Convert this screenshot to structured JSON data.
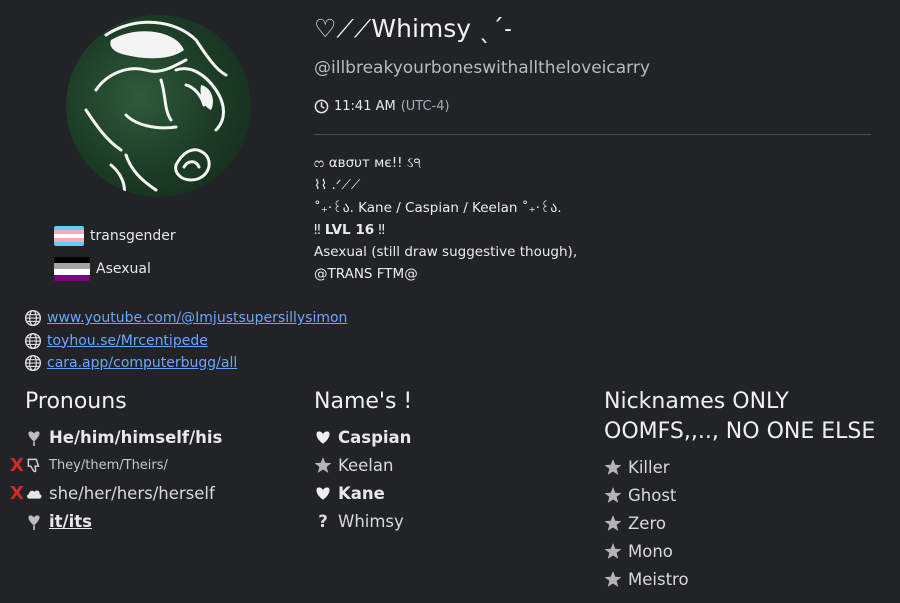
{
  "profile": {
    "display_name": "♡⟋⟋Whimsy ˎˊ˗",
    "handle": "@illbreakyourboneswithalltheloveicarry",
    "time": "11:41 AM",
    "timezone": "(UTC-4)"
  },
  "flags": [
    {
      "label": "transgender",
      "colors": [
        "#5bcefa",
        "#f5a9b8",
        "#ffffff",
        "#f5a9b8",
        "#5bcefa"
      ]
    },
    {
      "label": "Asexual",
      "colors": [
        "#000000",
        "#a3a3a3",
        "#ffffff",
        "#800080"
      ]
    }
  ],
  "bio": {
    "line1": "ᦂ αвσυт мє!! ઽ੧",
    "line2": "⌇⌇ .ᐟ⟋⟋",
    "line3": "˚₊‧꒰ა. Kane / Caspian / Keelan ˚₊‧꒰ა.",
    "line4_pre": "‼ ",
    "line4_bold": "LVL 16",
    "line4_post": " ‼",
    "line5": "Asexual (still draw suggestive though),",
    "line6": "@TRANS FTM@"
  },
  "links": [
    "www.youtube.com/@Imjustsupersillysimon",
    "toyhou.se/Mrcentipede",
    "cara.app/computerbugg/all"
  ],
  "pronouns": {
    "title": "Pronouns",
    "items": [
      {
        "text": "He/him/himself/his"
      },
      {
        "text": "They/them/Theirs/",
        "x": "X"
      },
      {
        "text": "she/her/hers/herself",
        "x": "X"
      },
      {
        "text": "it/its"
      }
    ]
  },
  "names": {
    "title": "Name's !",
    "items": [
      {
        "text": "Caspian"
      },
      {
        "text": "Keelan"
      },
      {
        "text": "Kane"
      },
      {
        "text": "Whimsy",
        "mark": "?"
      }
    ]
  },
  "nicknames": {
    "title_line1": "Nicknames ONLY",
    "title_line2": "OOMFS,,.., NO ONE ELSE",
    "items": [
      "Killer",
      "Ghost",
      "Zero",
      "Mono",
      "Meistro"
    ]
  },
  "colors": {
    "background": "#212326",
    "link": "#6aa6ff",
    "x_mark": "#d82727"
  }
}
